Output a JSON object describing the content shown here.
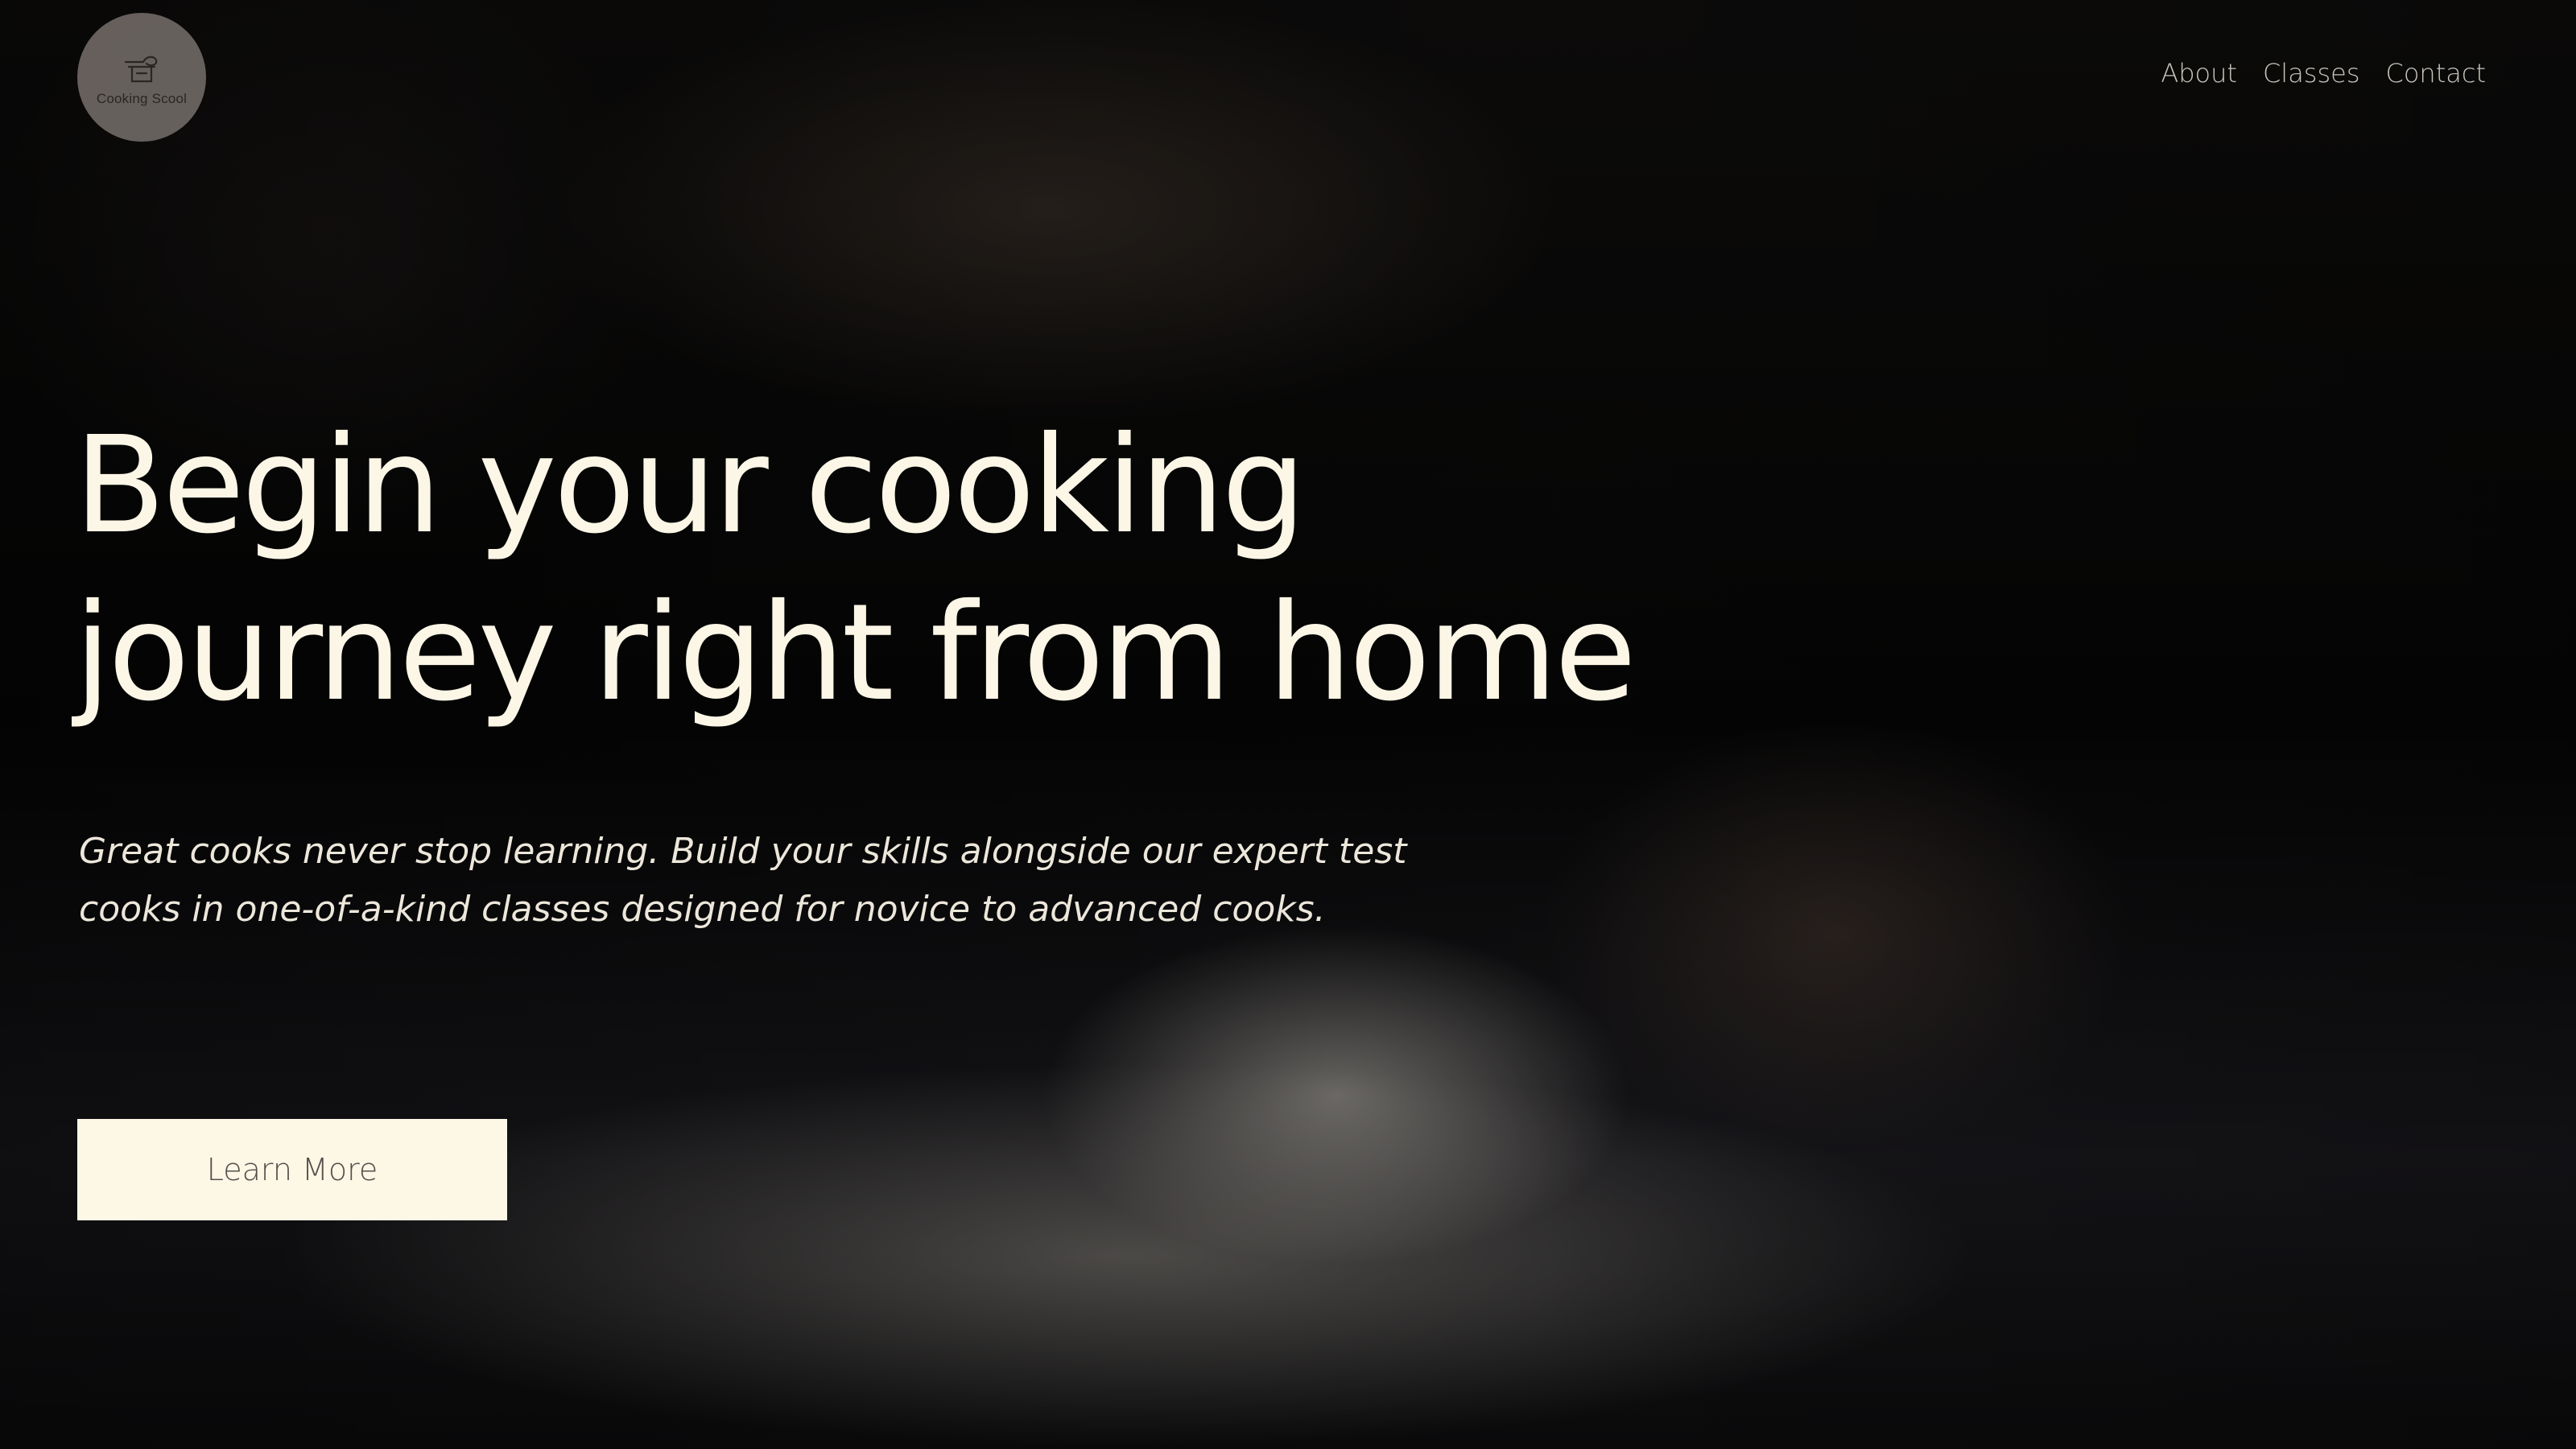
{
  "logo": {
    "text": "Cooking Scool",
    "icon": "cooking-pot-whisk-icon"
  },
  "nav": {
    "items": [
      "About",
      "Classes",
      "Contact"
    ]
  },
  "hero": {
    "headline_line1": "Begin your cooking",
    "headline_line2": "journey right from home",
    "tagline_line1": "Great cooks never stop learning. Build your skills alongside our expert test",
    "tagline_line2": "cooks in one-of-a-kind classes designed for novice to advanced cooks.",
    "cta_label": "Learn More"
  },
  "colors": {
    "headline": "#fbf6e6",
    "button_bg": "#fdf7e6",
    "button_text": "#54504a",
    "nav_text": "#c9c5bd",
    "logo_bg": "#807874"
  }
}
